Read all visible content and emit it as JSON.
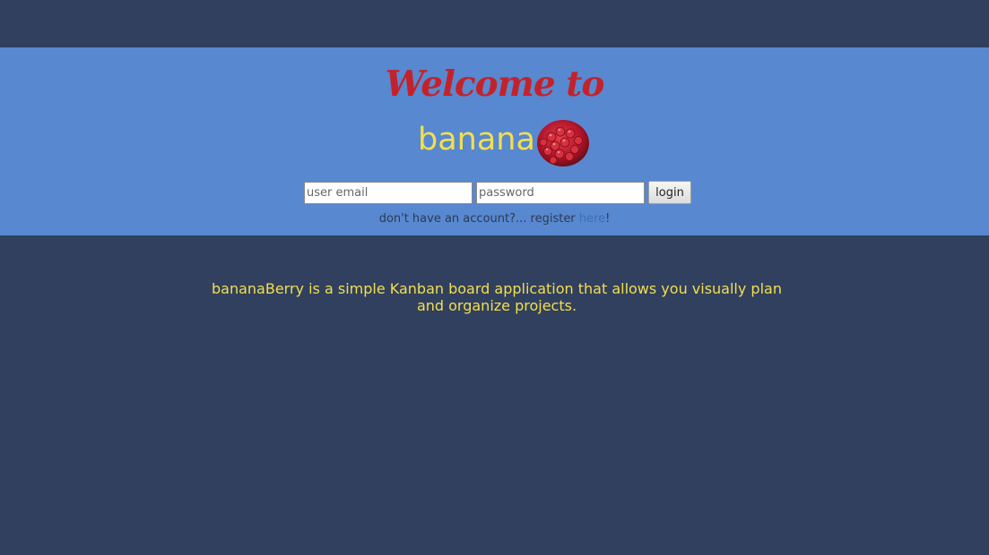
{
  "hero": {
    "welcome": "Welcome to",
    "brand_text": "banana",
    "brand_icon": "raspberry-icon"
  },
  "login": {
    "email_placeholder": "user email",
    "password_placeholder": "password",
    "button_label": "login"
  },
  "register": {
    "prefix": "don't have an account?... register ",
    "link_text": "here",
    "suffix": "!"
  },
  "description": "bananaBerry is a simple Kanban board application that allows you visually plan and organize projects.",
  "colors": {
    "page_bg": "#31405e",
    "hero_bg": "#5888d0",
    "welcome": "#c4222a",
    "brand": "#f3df4e",
    "link": "#3b6fb3"
  }
}
